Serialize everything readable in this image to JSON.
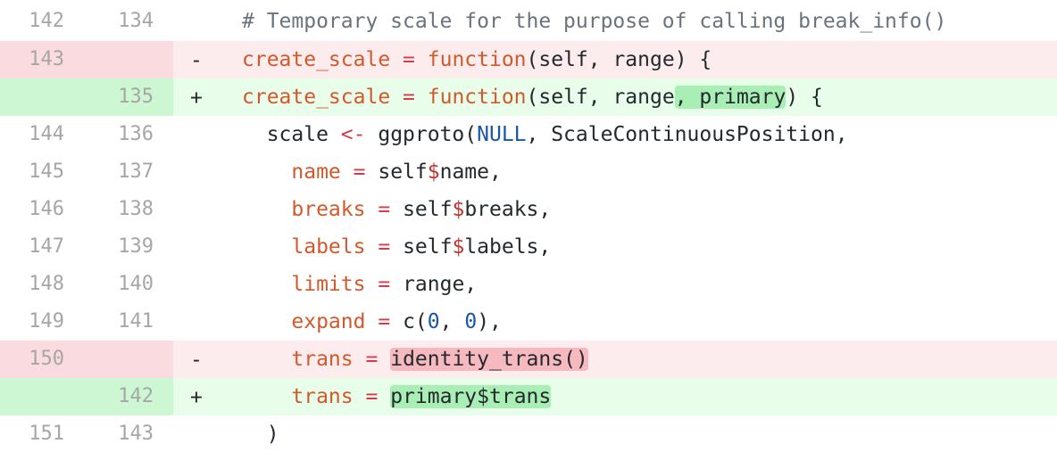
{
  "diff": {
    "rows": [
      {
        "old": "142",
        "new": "134",
        "marker": "",
        "type": "ctx"
      },
      {
        "old": "143",
        "new": "",
        "marker": "-",
        "type": "del"
      },
      {
        "old": "",
        "new": "135",
        "marker": "+",
        "type": "add"
      },
      {
        "old": "144",
        "new": "136",
        "marker": "",
        "type": "ctx"
      },
      {
        "old": "145",
        "new": "137",
        "marker": "",
        "type": "ctx"
      },
      {
        "old": "146",
        "new": "138",
        "marker": "",
        "type": "ctx"
      },
      {
        "old": "147",
        "new": "139",
        "marker": "",
        "type": "ctx"
      },
      {
        "old": "148",
        "new": "140",
        "marker": "",
        "type": "ctx"
      },
      {
        "old": "149",
        "new": "141",
        "marker": "",
        "type": "ctx"
      },
      {
        "old": "150",
        "new": "",
        "marker": "-",
        "type": "del"
      },
      {
        "old": "",
        "new": "142",
        "marker": "+",
        "type": "add"
      },
      {
        "old": "151",
        "new": "143",
        "marker": "",
        "type": "ctx"
      }
    ],
    "code": {
      "l0": {
        "comment": "# Temporary scale for the purpose of calling break_info()"
      },
      "l1": {
        "name": "create_scale",
        "eq": "=",
        "fn": "function",
        "args": "(self, range) {"
      },
      "l2": {
        "name": "create_scale",
        "eq": "=",
        "fn": "function",
        "a1": "(self, range",
        "hl": ", primary",
        "a2": ") {"
      },
      "l3": {
        "t1": "scale ",
        "arrow": "<-",
        "t2": " ggproto(",
        "null": "NULL",
        "t3": ", ScaleContinuousPosition,"
      },
      "l4": {
        "key": "name",
        "eq": "=",
        "pre": "self",
        "dollar": "$",
        "post": "name,"
      },
      "l5": {
        "key": "breaks",
        "eq": "=",
        "pre": "self",
        "dollar": "$",
        "post": "breaks,"
      },
      "l6": {
        "key": "labels",
        "eq": "=",
        "pre": "self",
        "dollar": "$",
        "post": "labels,"
      },
      "l7": {
        "key": "limits",
        "eq": "=",
        "val": "range,"
      },
      "l8": {
        "key": "expand",
        "eq": "=",
        "c": "c(",
        "z1": "0",
        "sep": ", ",
        "z2": "0",
        "end": "),"
      },
      "l9": {
        "key": "trans",
        "eq": "=",
        "hl": "identity_trans()"
      },
      "l10": {
        "key": "trans",
        "eq": "=",
        "hl": "primary$trans"
      },
      "l11": {
        "close": ")"
      }
    }
  },
  "colors": {
    "keyword": "#d05a2c",
    "operator": "#d73a49",
    "constant": "#1955a8",
    "deleted_bg": "#fdecee",
    "added_bg": "#e9fdeb",
    "deleted_highlight": "#f6b9c0",
    "added_highlight": "#a9eeb4"
  }
}
